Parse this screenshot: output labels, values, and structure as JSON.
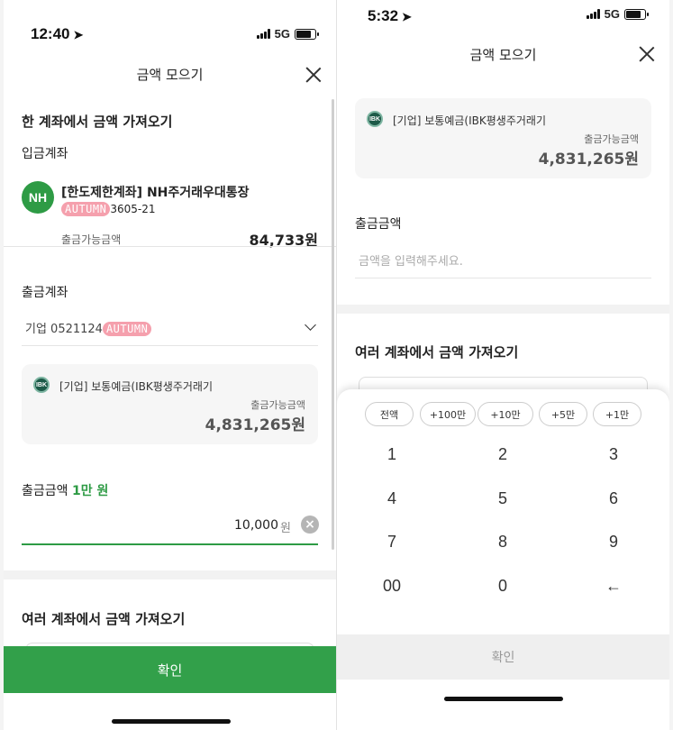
{
  "left": {
    "status": {
      "time": "12:40",
      "network": "5G"
    },
    "header": {
      "title": "금액 모으기"
    },
    "section_single": {
      "title": "한 계좌에서 금액 가져오기"
    },
    "deposit": {
      "label": "입금계좌",
      "bank_logo": "NH",
      "account_name": "[한도제한계좌] NH주거래우대통장",
      "redacted": "AUTUMN",
      "account_suffix": "3605-21",
      "balance_label": "출금가능금액",
      "balance": "84,733원"
    },
    "withdraw": {
      "label": "출금계좌",
      "selected_prefix": "기업 0521124",
      "redacted": "AUTUMN",
      "card": {
        "bank_logo": "IBK",
        "account": "[기업] 보통예금(IBK평생주거래기",
        "balance_label": "출금가능금액",
        "balance": "4,831,265원"
      }
    },
    "amount": {
      "label": "출금금액",
      "hint": "1만 원",
      "value": "10,000",
      "unit": "원",
      "clear_glyph": "×"
    },
    "section_multi": {
      "title": "여러 계좌에서 금액 가져오기"
    },
    "confirm_label": "확인",
    "colors": {
      "accent": "#32a04a",
      "redact": "#f5a0ad"
    }
  },
  "right": {
    "status": {
      "time": "5:32",
      "network": "5G"
    },
    "header": {
      "title": "금액 모으기"
    },
    "card": {
      "bank_logo": "IBK",
      "account": "[기업] 보통예금(IBK평생주거래기",
      "balance_label": "출금가능금액",
      "balance": "4,831,265원"
    },
    "amount": {
      "label": "출금금액",
      "placeholder": "금액을 입력해주세요."
    },
    "section_multi": {
      "title": "여러 계좌에서 금액 가져오기"
    },
    "chips": [
      "전액",
      "+100만",
      "+10만",
      "+5만",
      "+1만"
    ],
    "keys": [
      "1",
      "2",
      "3",
      "4",
      "5",
      "6",
      "7",
      "8",
      "9",
      "00",
      "0",
      "←"
    ],
    "confirm_label": "확인"
  }
}
